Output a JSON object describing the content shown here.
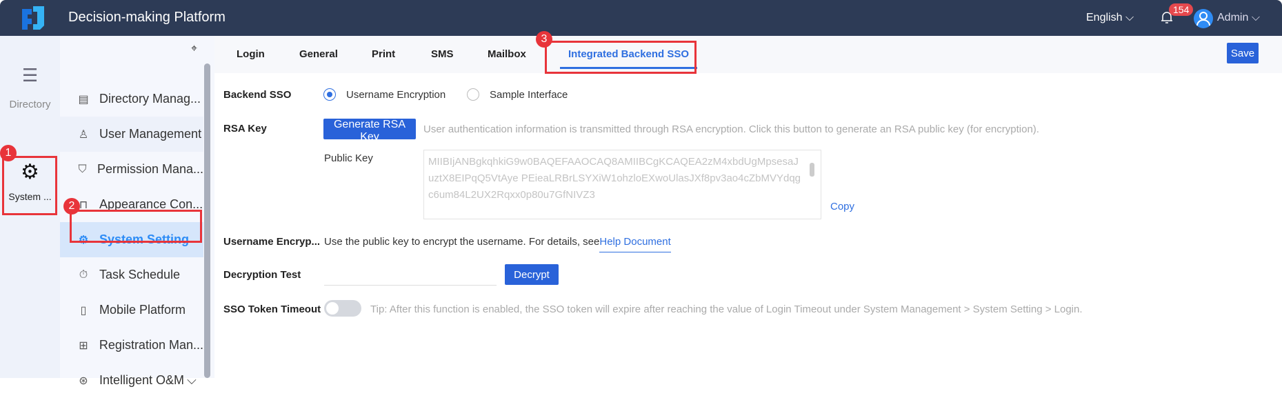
{
  "header": {
    "title": "Decision-making Platform",
    "language": "English",
    "notifications": "154",
    "user": "Admin"
  },
  "rail": {
    "items": [
      {
        "label": "Directory",
        "icon": "list-icon"
      },
      {
        "label": "System ...",
        "icon": "gear-icon"
      }
    ]
  },
  "sidebar": {
    "items": [
      {
        "label": "Directory Manag...",
        "icon": "document-icon"
      },
      {
        "label": "User Management",
        "icon": "user-icon"
      },
      {
        "label": "Permission Mana...",
        "icon": "shield-icon"
      },
      {
        "label": "Appearance Con...",
        "icon": "paint-roller-icon"
      },
      {
        "label": "System Setting",
        "icon": "gear-icon"
      },
      {
        "label": "Task Schedule",
        "icon": "stopwatch-icon"
      },
      {
        "label": "Mobile Platform",
        "icon": "mobile-icon"
      },
      {
        "label": "Registration Man...",
        "icon": "form-icon"
      },
      {
        "label": "Intelligent O&M",
        "icon": "ops-icon"
      }
    ]
  },
  "tabs": [
    "Login",
    "General",
    "Print",
    "SMS",
    "Mailbox",
    "Integrated Backend SSO"
  ],
  "save_label": "Save",
  "form": {
    "backend_sso_label": "Backend SSO",
    "opt1": "Username Encryption",
    "opt2": "Sample Interface",
    "rsa_label": "RSA Key",
    "generate_label": "Generate RSA Key",
    "rsa_tip": "User authentication information is transmitted through RSA encryption. Click this button to generate an RSA public key (for encryption).",
    "public_key_label": "Public Key",
    "public_key": "MIIBIjANBgkqhkiG9w0BAQEFAAOCAQ8AMIIBCgKCAQEA2zM4xbdUgMpsesaJuztX8EIPqQ5VtAye PEieaLRBrLSYXiW1ohzloEXwoUlasJXf8pv3ao4cZbMVYdqgc6um84L2UX2Rqxx0p80u7GfNIVZ3",
    "copy_label": "Copy",
    "username_label": "Username Encryp...",
    "username_text": "Use the public key to encrypt the username. For details, see",
    "help_link": "Help Document",
    "decrypt_label": "Decryption Test",
    "decrypt_btn": "Decrypt",
    "timeout_label": "SSO Token Timeout",
    "timeout_tip": "Tip: After this function is enabled, the SSO token will expire after reaching the value of Login Timeout under System Management > System Setting > Login."
  },
  "markers": [
    "1",
    "2",
    "3"
  ]
}
